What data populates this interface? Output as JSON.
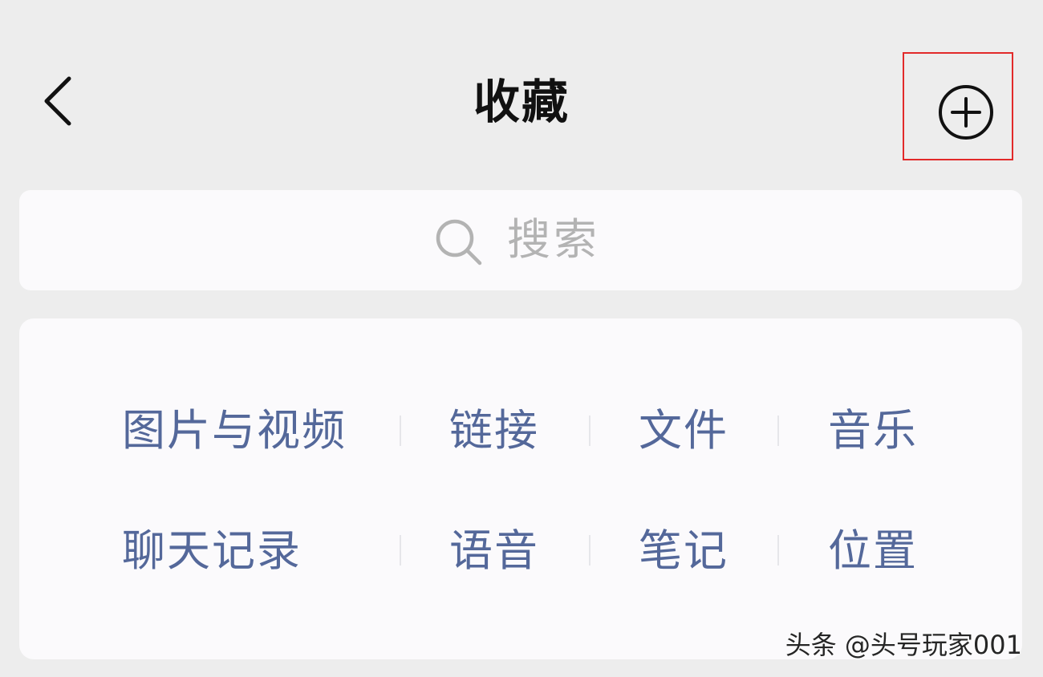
{
  "header": {
    "title": "收藏",
    "back_icon": "chevron-left-icon",
    "add_icon": "plus-circle-icon",
    "highlight_color": "#e22a2a"
  },
  "search": {
    "placeholder": "搜索",
    "icon": "search-icon"
  },
  "categories": {
    "row1": [
      "图片与视频",
      "链接",
      "文件",
      "音乐"
    ],
    "row2": [
      "聊天记录",
      "语音",
      "笔记",
      "位置"
    ],
    "link_color": "#54689a"
  },
  "watermark": "头条 @头号玩家001"
}
